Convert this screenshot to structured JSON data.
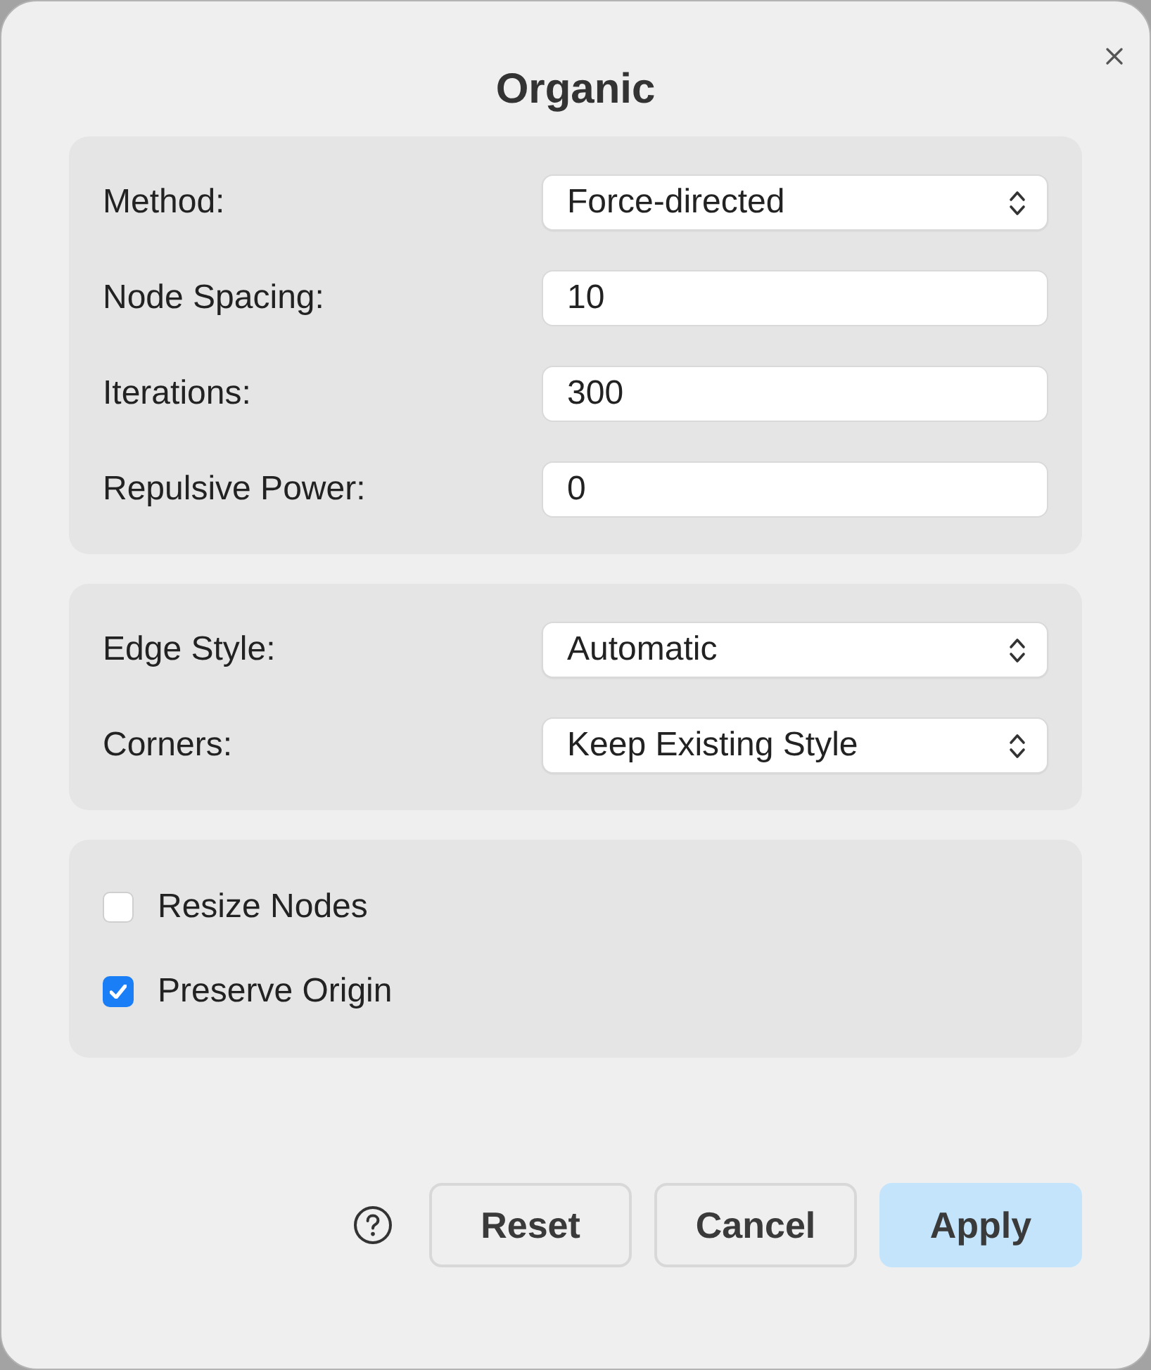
{
  "dialog": {
    "title": "Organic"
  },
  "sections": [
    {
      "rows": [
        {
          "kind": "select",
          "label": "Method:",
          "value": "Force-directed"
        },
        {
          "kind": "input",
          "label": "Node Spacing:",
          "value": "10"
        },
        {
          "kind": "input",
          "label": "Iterations:",
          "value": "300"
        },
        {
          "kind": "input",
          "label": "Repulsive Power:",
          "value": "0"
        }
      ]
    },
    {
      "rows": [
        {
          "kind": "select",
          "label": "Edge Style:",
          "value": "Automatic"
        },
        {
          "kind": "select",
          "label": "Corners:",
          "value": "Keep Existing Style"
        }
      ]
    },
    {
      "rows": [
        {
          "kind": "checkbox",
          "label": "Resize Nodes",
          "checked": false
        },
        {
          "kind": "checkbox",
          "label": "Preserve Origin",
          "checked": true
        }
      ]
    }
  ],
  "buttons": [
    {
      "kind": "secondary",
      "label": "Reset"
    },
    {
      "kind": "secondary",
      "label": "Cancel"
    },
    {
      "kind": "primary",
      "label": "Apply"
    }
  ]
}
